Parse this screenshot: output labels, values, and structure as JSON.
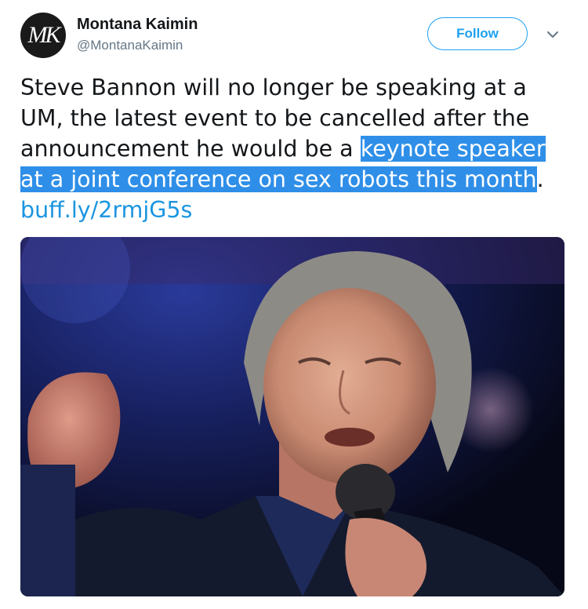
{
  "account": {
    "avatar_text": "MK",
    "name": "Montana Kaimin",
    "handle": "@MontanaKaimin"
  },
  "actions": {
    "follow_label": "Follow",
    "more_icon": "chevron-down-icon"
  },
  "tweet": {
    "text_plain": "Steve Bannon will no longer be speaking at a UM, the latest event to be cancelled after the announcement he would be a ",
    "text_highlighted": "keynote speaker at a joint conference on sex robots this month",
    "text_after": ". ",
    "link": "buff.ly/2rmjG5s"
  },
  "colors": {
    "accent": "#1da1f2",
    "link": "#1b95e0",
    "highlight": "#2f8fe8"
  }
}
